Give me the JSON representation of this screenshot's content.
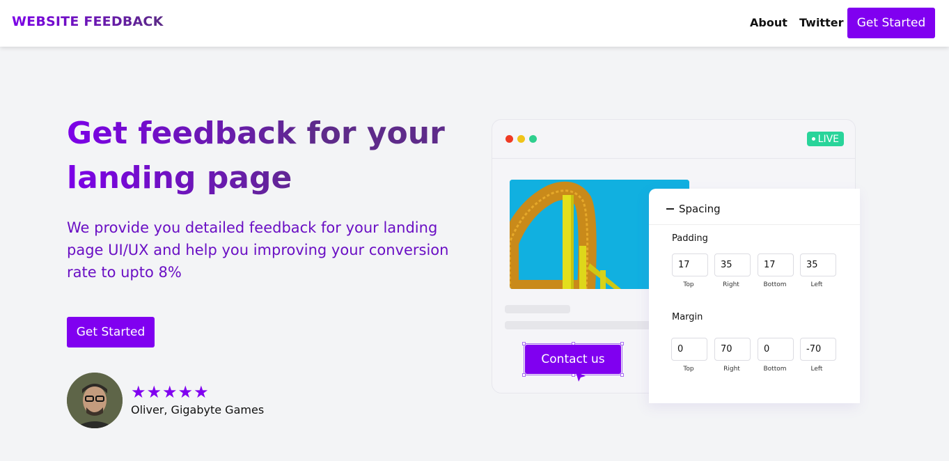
{
  "nav": {
    "brand": "WEBSITE FEEDBACK",
    "links": [
      "About",
      "Twitter"
    ],
    "cta": "Get Started"
  },
  "hero": {
    "title": "Get feedback for your landing page",
    "subtitle": "We provide you detailed feedback for your landing page UI/UX and help you improving your conversion rate to upto 8%",
    "cta": "Get Started"
  },
  "testimonial": {
    "stars": "★★★★★",
    "rating": 5,
    "author": "Oliver, Gigabyte Games"
  },
  "mock": {
    "live_label": "LIVE",
    "contact_button": "Contact us",
    "panel": {
      "title": "Spacing",
      "padding": {
        "label": "Padding",
        "values": [
          "17",
          "35",
          "17",
          "35"
        ],
        "captions": [
          "Top",
          "Right",
          "Bottom",
          "Left"
        ]
      },
      "margin": {
        "label": "Margin",
        "values": [
          "0",
          "70",
          "0",
          "-70"
        ],
        "captions": [
          "Top",
          "Right",
          "Bottom",
          "Left"
        ]
      }
    }
  },
  "colors": {
    "accent": "#8000f0",
    "live": "#29d49a",
    "background": "#f3f4f6"
  }
}
